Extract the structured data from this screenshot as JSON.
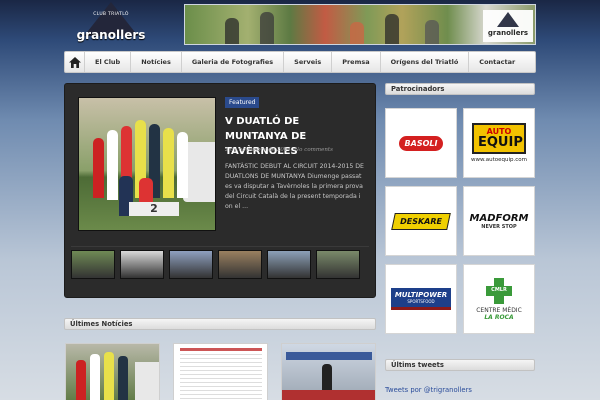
{
  "header": {
    "logo_club": "CLUB TRIATLÓ",
    "logo_name": "granollers",
    "banner_logo": "granollers"
  },
  "nav": {
    "items": [
      "El Club",
      "Notícies",
      "Galeria de Fotografies",
      "Serveis",
      "Premsa",
      "Orígens del Triatló",
      "Contactar"
    ]
  },
  "slider": {
    "badge": "Featured",
    "title": "V DUATLÓ DE MUNTANYA DE TAVÈRNOLES",
    "date": "2 de novembre de 2014, No comments",
    "excerpt": "FANTÀSTIC DEBUT AL CIRCUIT 2014-2015 DE DUATLONS DE MUNTANYA   Diumenge passat es va disputar a Tavèrnoles la primera prova del Circuit Català de la present temporada i on el ...",
    "photo_number": "2",
    "thumb_colors": [
      "#6f8a55",
      "#d9d9d9",
      "#8fa0c0",
      "#9a8060",
      "#8ca0b8",
      "#7a8a6a"
    ]
  },
  "sidebar": {
    "sponsors_title": "Patrocinadors",
    "sponsors": [
      {
        "name": "BASOLI"
      },
      {
        "name": "AUTO",
        "name2": "EQUIP",
        "url": "www.autoequip.com"
      },
      {
        "name": "DESKARE"
      },
      {
        "name": "MADFORM",
        "tag": "NEVER STOP"
      },
      {
        "name": "MULTIPOWER",
        "tag": "SPORTSFOOD"
      },
      {
        "name": "CMLR",
        "label": "CENTRE MÈDIC",
        "tag": "LA ROCA"
      }
    ],
    "tweets_title": "Últims tweets",
    "tweets_link": "Tweets por @trigranollers"
  },
  "news": {
    "title": "Últimes Notícies"
  },
  "colors": {
    "badge": "#2a4a8c",
    "auto_equip_yellow": "#f2c200",
    "cross_green": "#3a9a3a",
    "link_blue": "#2a4c9a"
  }
}
